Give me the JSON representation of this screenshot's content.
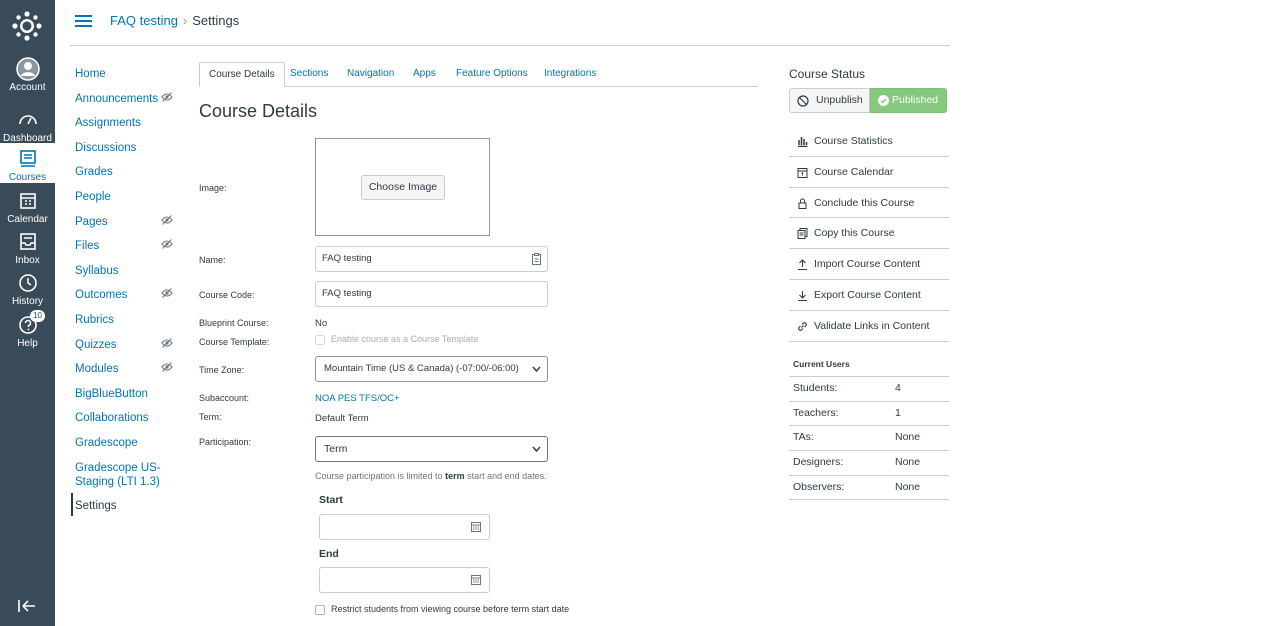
{
  "global_nav": {
    "items": [
      {
        "label": "Account"
      },
      {
        "label": "Dashboard"
      },
      {
        "label": "Courses"
      },
      {
        "label": "Calendar"
      },
      {
        "label": "Inbox"
      },
      {
        "label": "History"
      },
      {
        "label": "Help",
        "badge": "10"
      }
    ]
  },
  "breadcrumb": {
    "course": "FAQ testing",
    "separator": "›",
    "page": "Settings"
  },
  "course_nav": {
    "items": [
      {
        "label": "Home"
      },
      {
        "label": "Announcements"
      },
      {
        "label": "Assignments"
      },
      {
        "label": "Discussions"
      },
      {
        "label": "Grades"
      },
      {
        "label": "People"
      },
      {
        "label": "Pages"
      },
      {
        "label": "Files"
      },
      {
        "label": "Syllabus"
      },
      {
        "label": "Outcomes"
      },
      {
        "label": "Rubrics"
      },
      {
        "label": "Quizzes"
      },
      {
        "label": "Modules"
      },
      {
        "label": "BigBlueButton"
      },
      {
        "label": "Collaborations"
      },
      {
        "label": "Gradescope"
      },
      {
        "label": "Gradescope US-Staging (LTI 1.3)"
      },
      {
        "label": "Settings"
      }
    ]
  },
  "tabs": [
    "Course Details",
    "Sections",
    "Navigation",
    "Apps",
    "Feature Options",
    "Integrations"
  ],
  "main": {
    "heading": "Course Details",
    "image_label": "Image:",
    "choose_image": "Choose Image",
    "name_label": "Name:",
    "name_value": "FAQ testing",
    "code_label": "Course Code:",
    "code_value": "FAQ testing",
    "blueprint_label": "Blueprint Course:",
    "blueprint_value": "No",
    "template_label": "Course Template:",
    "template_checkbox": "Enable course as a Course Template",
    "timezone_label": "Time Zone:",
    "timezone_value": "Mountain Time (US & Canada) (-07:00/-06:00)",
    "subaccount_label": "Subaccount:",
    "subaccount_value": "NOA PES TFS/OC+",
    "term_label": "Term:",
    "term_value": "Default Term",
    "participation_label": "Participation:",
    "participation_value": "Term",
    "participation_note_pre": "Course participation is limited to",
    "participation_note_term": "term",
    "participation_note_post": "start and end dates.",
    "start_label": "Start",
    "end_label": "End",
    "restrict_label": "Restrict students from viewing course before term start date"
  },
  "sidebar": {
    "status_title": "Course Status",
    "unpublish": "Unpublish",
    "published": "Published",
    "links": [
      {
        "label": "Course Statistics",
        "icon": "bar-chart-icon"
      },
      {
        "label": "Course Calendar",
        "icon": "calendar-icon"
      },
      {
        "label": "Conclude this Course",
        "icon": "lock-icon"
      },
      {
        "label": "Copy this Course",
        "icon": "copy-icon"
      },
      {
        "label": "Import Course Content",
        "icon": "upload-icon"
      },
      {
        "label": "Export Course Content",
        "icon": "download-icon"
      },
      {
        "label": "Validate Links in Content",
        "icon": "link-icon"
      }
    ],
    "current_users_title": "Current Users",
    "users": [
      {
        "k": "Students:",
        "v": "4"
      },
      {
        "k": "Teachers:",
        "v": "1"
      },
      {
        "k": "TAs:",
        "v": "None"
      },
      {
        "k": "Designers:",
        "v": "None"
      },
      {
        "k": "Observers:",
        "v": "None"
      }
    ]
  },
  "colors": {
    "nav_bg": "#394b58",
    "link": "#0374b5",
    "published": "#85c97f"
  }
}
